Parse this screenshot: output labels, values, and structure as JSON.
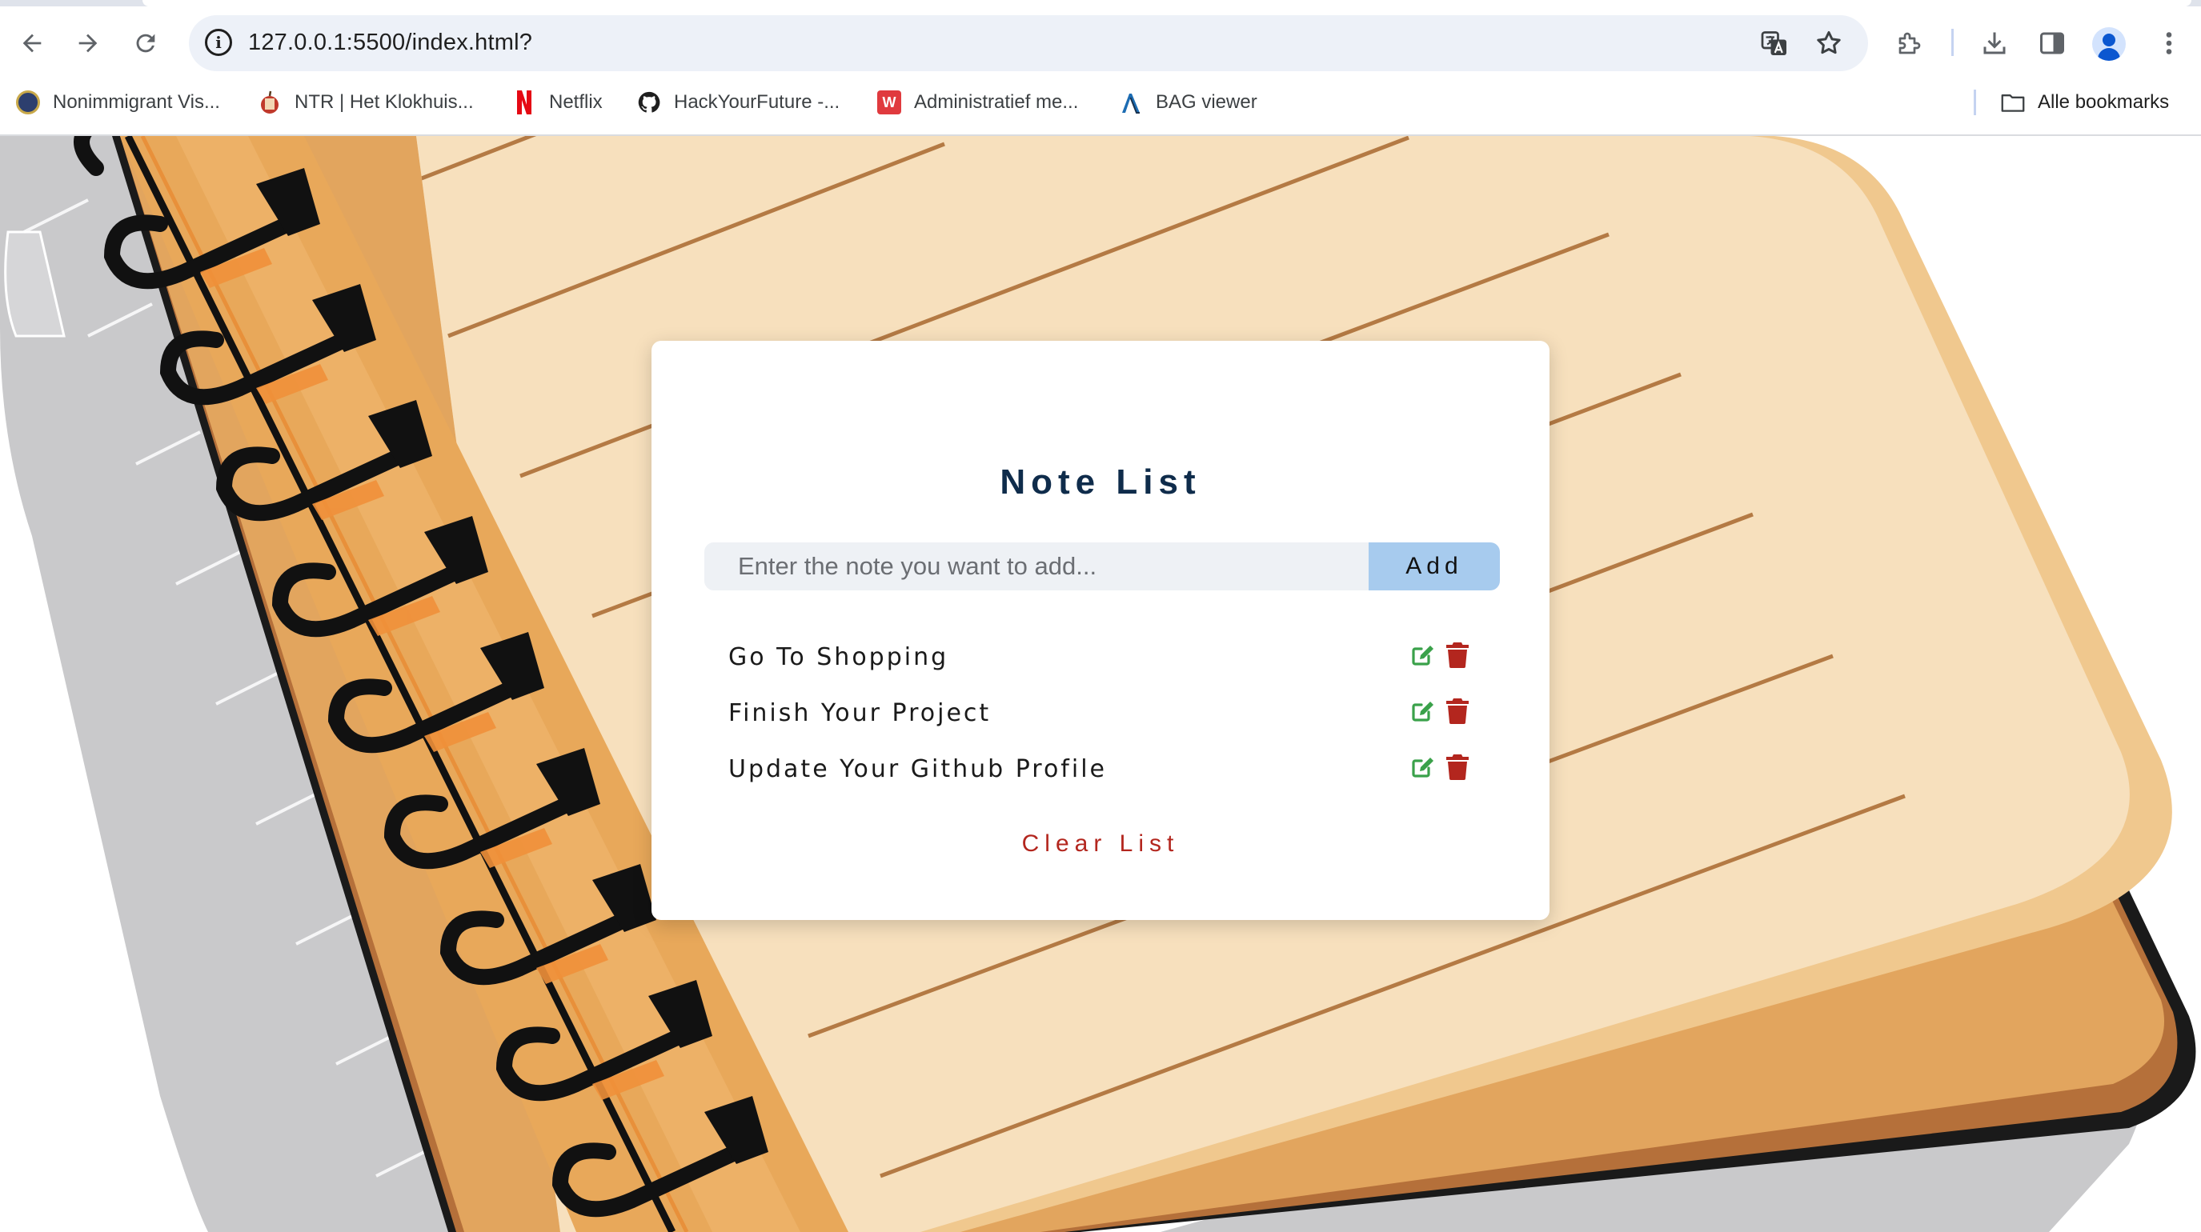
{
  "browser": {
    "url": "127.0.0.1:5500/index.html?",
    "bookmarks": [
      {
        "label": "Nonimmigrant Vis...",
        "icon": "seal-icon"
      },
      {
        "label": "NTR | Het Klokhuis...",
        "icon": "apple-icon"
      },
      {
        "label": "Netflix",
        "icon": "netflix-icon"
      },
      {
        "label": "HackYourFuture -...",
        "icon": "github-icon"
      },
      {
        "label": "Administratief me...",
        "icon": "w-icon"
      },
      {
        "label": "BAG viewer",
        "icon": "bag-icon"
      }
    ],
    "all_bookmarks_label": "Alle bookmarks"
  },
  "app": {
    "title": "Note List",
    "input_placeholder": "Enter the note you want to add...",
    "input_value": "",
    "add_label": "Add",
    "notes": [
      {
        "text": "Go To Shopping"
      },
      {
        "text": "Finish Your Project"
      },
      {
        "text": "Update Your Github Profile"
      }
    ],
    "clear_label": "Clear List"
  },
  "colors": {
    "title": "#0f2c4b",
    "add_button": "#a7cbee",
    "edit_icon": "#3aa14a",
    "delete_icon": "#b3261e",
    "clear_text": "#b3261e"
  }
}
